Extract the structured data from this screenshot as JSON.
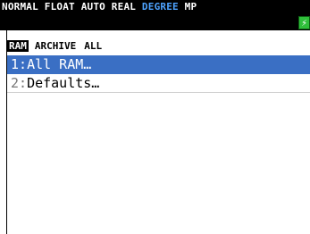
{
  "status_bar": {
    "prefix": "NORMAL FLOAT AUTO REAL ",
    "angle_mode": "DEGREE",
    "suffix": " MP",
    "accent_color": "#4ea3ff",
    "battery_icon": "battery-icon"
  },
  "tabs": [
    {
      "label": "RAM",
      "active": true
    },
    {
      "label": "ARCHIVE",
      "active": false
    },
    {
      "label": "ALL",
      "active": false
    }
  ],
  "menu": {
    "items": [
      {
        "number": "1:",
        "label": "All RAM…",
        "selected": true
      },
      {
        "number": "2:",
        "label": "Defaults…",
        "selected": false
      }
    ]
  },
  "selection_color": "#3a6fc4"
}
